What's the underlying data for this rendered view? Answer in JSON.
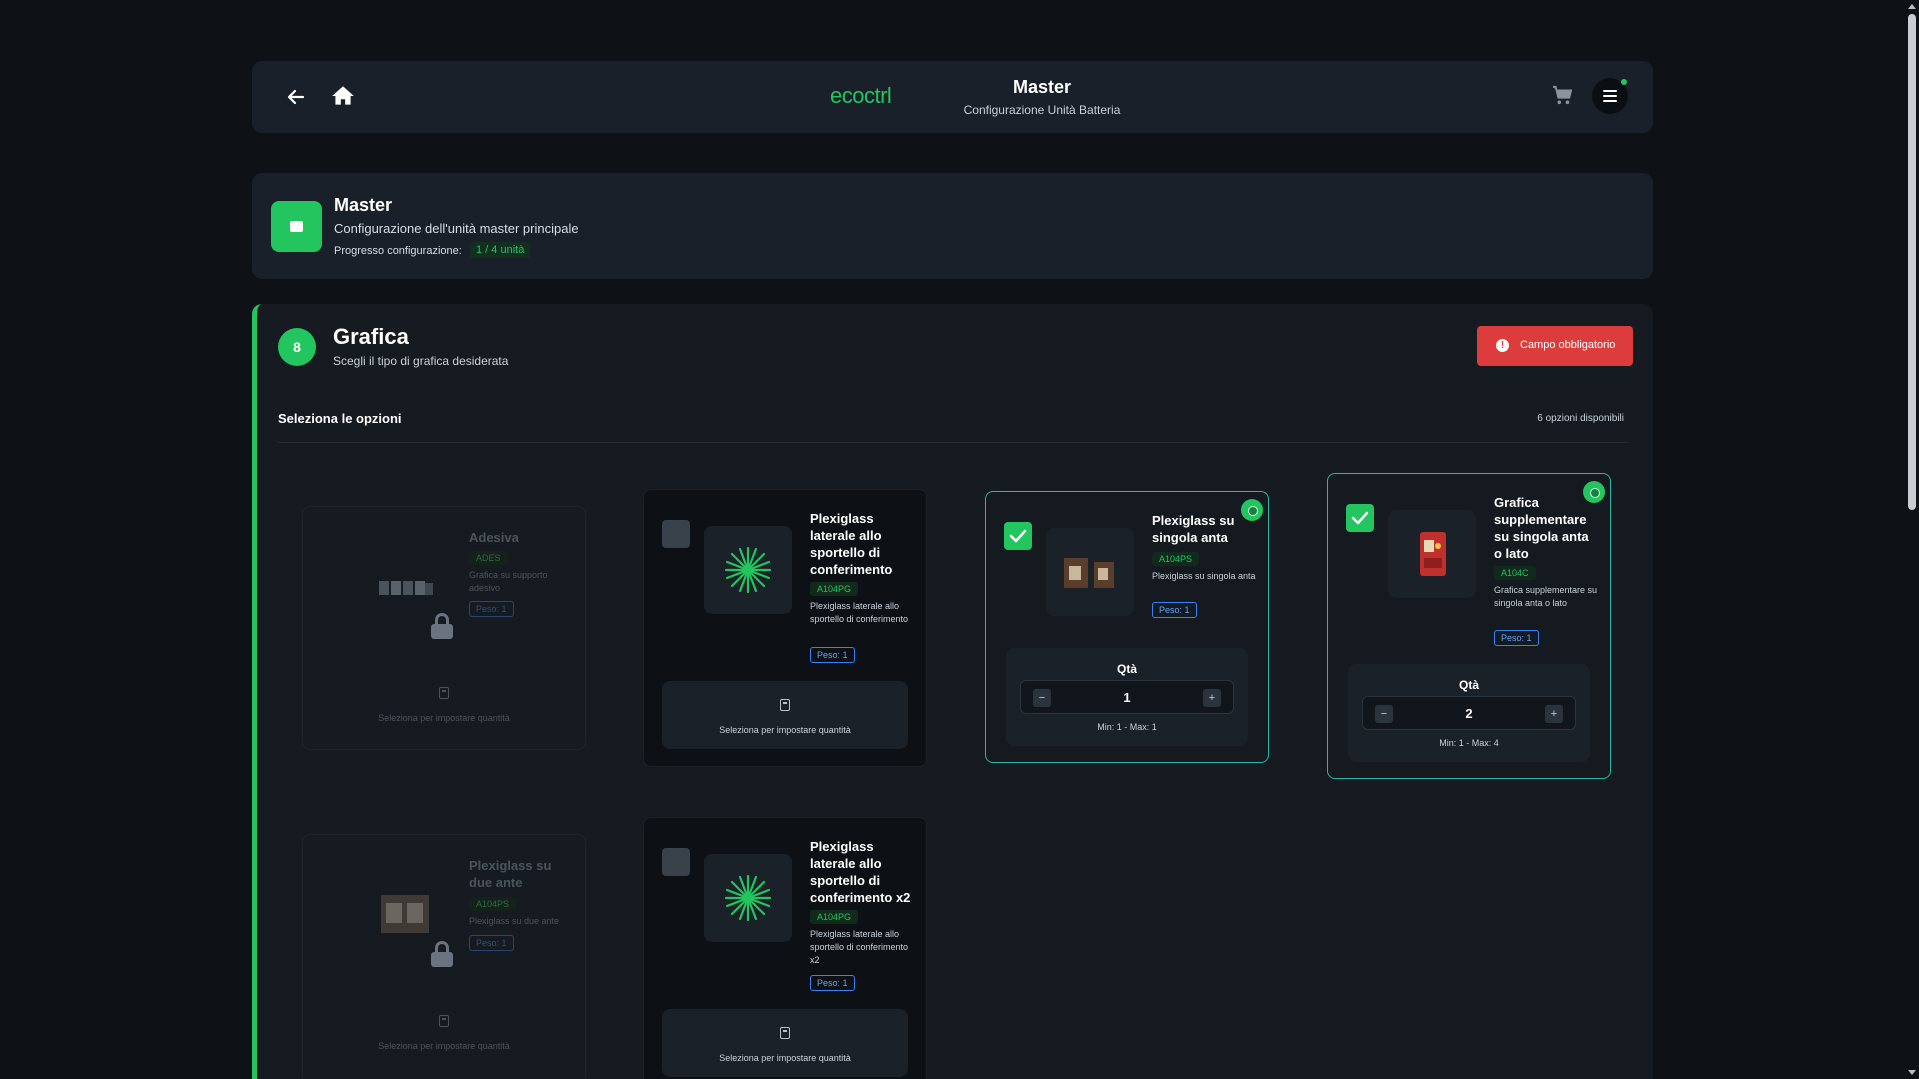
{
  "header": {
    "brand": "ecoctrl",
    "title": "Master",
    "subtitle": "Configurazione Unità Batteria",
    "icons": {
      "back": "arrow-left-icon",
      "home": "home-icon",
      "cart": "cart-icon",
      "menu": "hamburger-menu-icon"
    }
  },
  "master": {
    "title": "Master",
    "subtitle": "Configurazione dell'unità master principale",
    "progress_label": "Progresso configurazione:",
    "progress_value": "1 / 4 unità",
    "icon": "box-icon"
  },
  "section": {
    "step": "8",
    "title": "Grafica",
    "subtitle": "Scegli il tipo di grafica desiderata",
    "required_label": "Campo obbligatorio",
    "options_title": "Seleziona le opzioni",
    "options_count": "6 opzioni disponibili"
  },
  "colors": {
    "accent": "#22c55e",
    "danger": "#dc3c3c",
    "peso": "#3b82f6",
    "selected_border": "#2fb5a0"
  },
  "options": [
    {
      "name": "Adesiva",
      "code": "ADES",
      "desc": "Grafica su supporto adesivo",
      "peso": "Peso: 1",
      "state": "locked",
      "qty_hint": "Seleziona per impostare quantità",
      "icon": "stickers-image"
    },
    {
      "name": "Plexiglass laterale allo sportello di conferimento",
      "code": "A104PG",
      "desc": "Plexiglass laterale allo sportello di conferimento",
      "peso": "Peso: 1",
      "state": "unselected",
      "qty_hint": "Seleziona per impostare quantità",
      "icon": "green-burst-icon"
    },
    {
      "name": "Plexiglass su singola anta",
      "code": "A104PS",
      "desc": "Plexiglass su singola anta",
      "peso": "Peso: 1",
      "state": "selected",
      "qty_label": "Qtà",
      "qty": "1",
      "range": "Min: 1 - Max: 1",
      "icon": "cabinet-image"
    },
    {
      "name": "Grafica supplementare su singola anta o lato",
      "code": "A104C",
      "desc": "Grafica supplementare su singola anta o lato",
      "peso": "Peso: 1",
      "state": "selected",
      "qty_label": "Qtà",
      "qty": "2",
      "range": "Min: 1 - Max: 4",
      "icon": "red-cabinet-image"
    },
    {
      "name": "Plexiglass su due ante",
      "code": "A104PS",
      "desc": "Plexiglass su due ante",
      "peso": "Peso: 1",
      "state": "locked",
      "qty_hint": "Seleziona per impostare quantità",
      "icon": "double-cabinet-image"
    },
    {
      "name": "Plexiglass laterale allo sportello di conferimento x2",
      "code": "A104PG",
      "desc": "Plexiglass laterale allo sportello di conferimento x2",
      "peso": "Peso: 1",
      "state": "unselected",
      "qty_hint": "Seleziona per impostare quantità",
      "icon": "green-burst-icon"
    }
  ]
}
